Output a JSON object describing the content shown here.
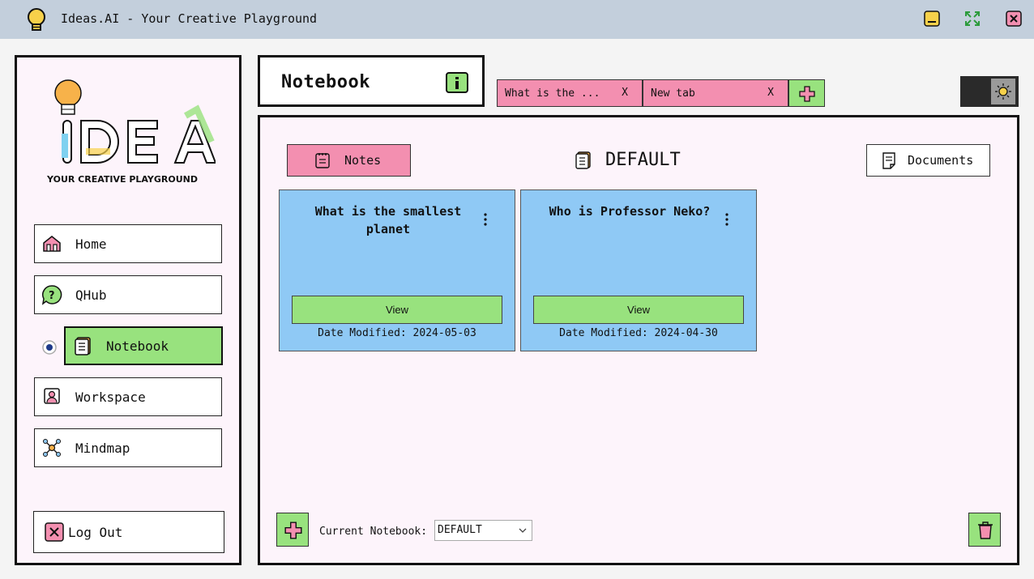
{
  "window": {
    "title": "Ideas.AI - Your Creative Playground",
    "controls": [
      "minimize",
      "maximize",
      "close"
    ]
  },
  "sidebar": {
    "logo_text": "IDEA",
    "logo_subtitle": "YOUR CREATIVE PLAYGROUND",
    "items": [
      {
        "label": "Home",
        "icon": "home-icon"
      },
      {
        "label": "QHub",
        "icon": "question-icon"
      },
      {
        "label": "Notebook",
        "icon": "notebook-icon",
        "active": true
      },
      {
        "label": "Workspace",
        "icon": "workspace-icon"
      },
      {
        "label": "Mindmap",
        "icon": "mindmap-icon"
      }
    ],
    "logout_label": "Log Out"
  },
  "header": {
    "title": "Notebook"
  },
  "tabs": [
    {
      "label": "What is the ...",
      "close": "X"
    },
    {
      "label": "New tab",
      "close": "X"
    }
  ],
  "main": {
    "notes_label": "Notes",
    "documents_label": "Documents",
    "notebook_name": "DEFAULT",
    "cards": [
      {
        "title": "What is the smallest planet",
        "view_label": "View",
        "date": "Date Modified: 2024-05-03"
      },
      {
        "title": "Who is Professor Neko?",
        "view_label": "View",
        "date": "Date Modified: 2024-04-30"
      }
    ],
    "current_notebook_label": "Current Notebook:",
    "current_notebook_value": "DEFAULT"
  },
  "colors": {
    "titlebar": "#c3cfdc",
    "pink": "#f38fb0",
    "green": "#98e27e",
    "card_blue": "#8fc9f5",
    "panel_bg": "#fdf4fb"
  }
}
